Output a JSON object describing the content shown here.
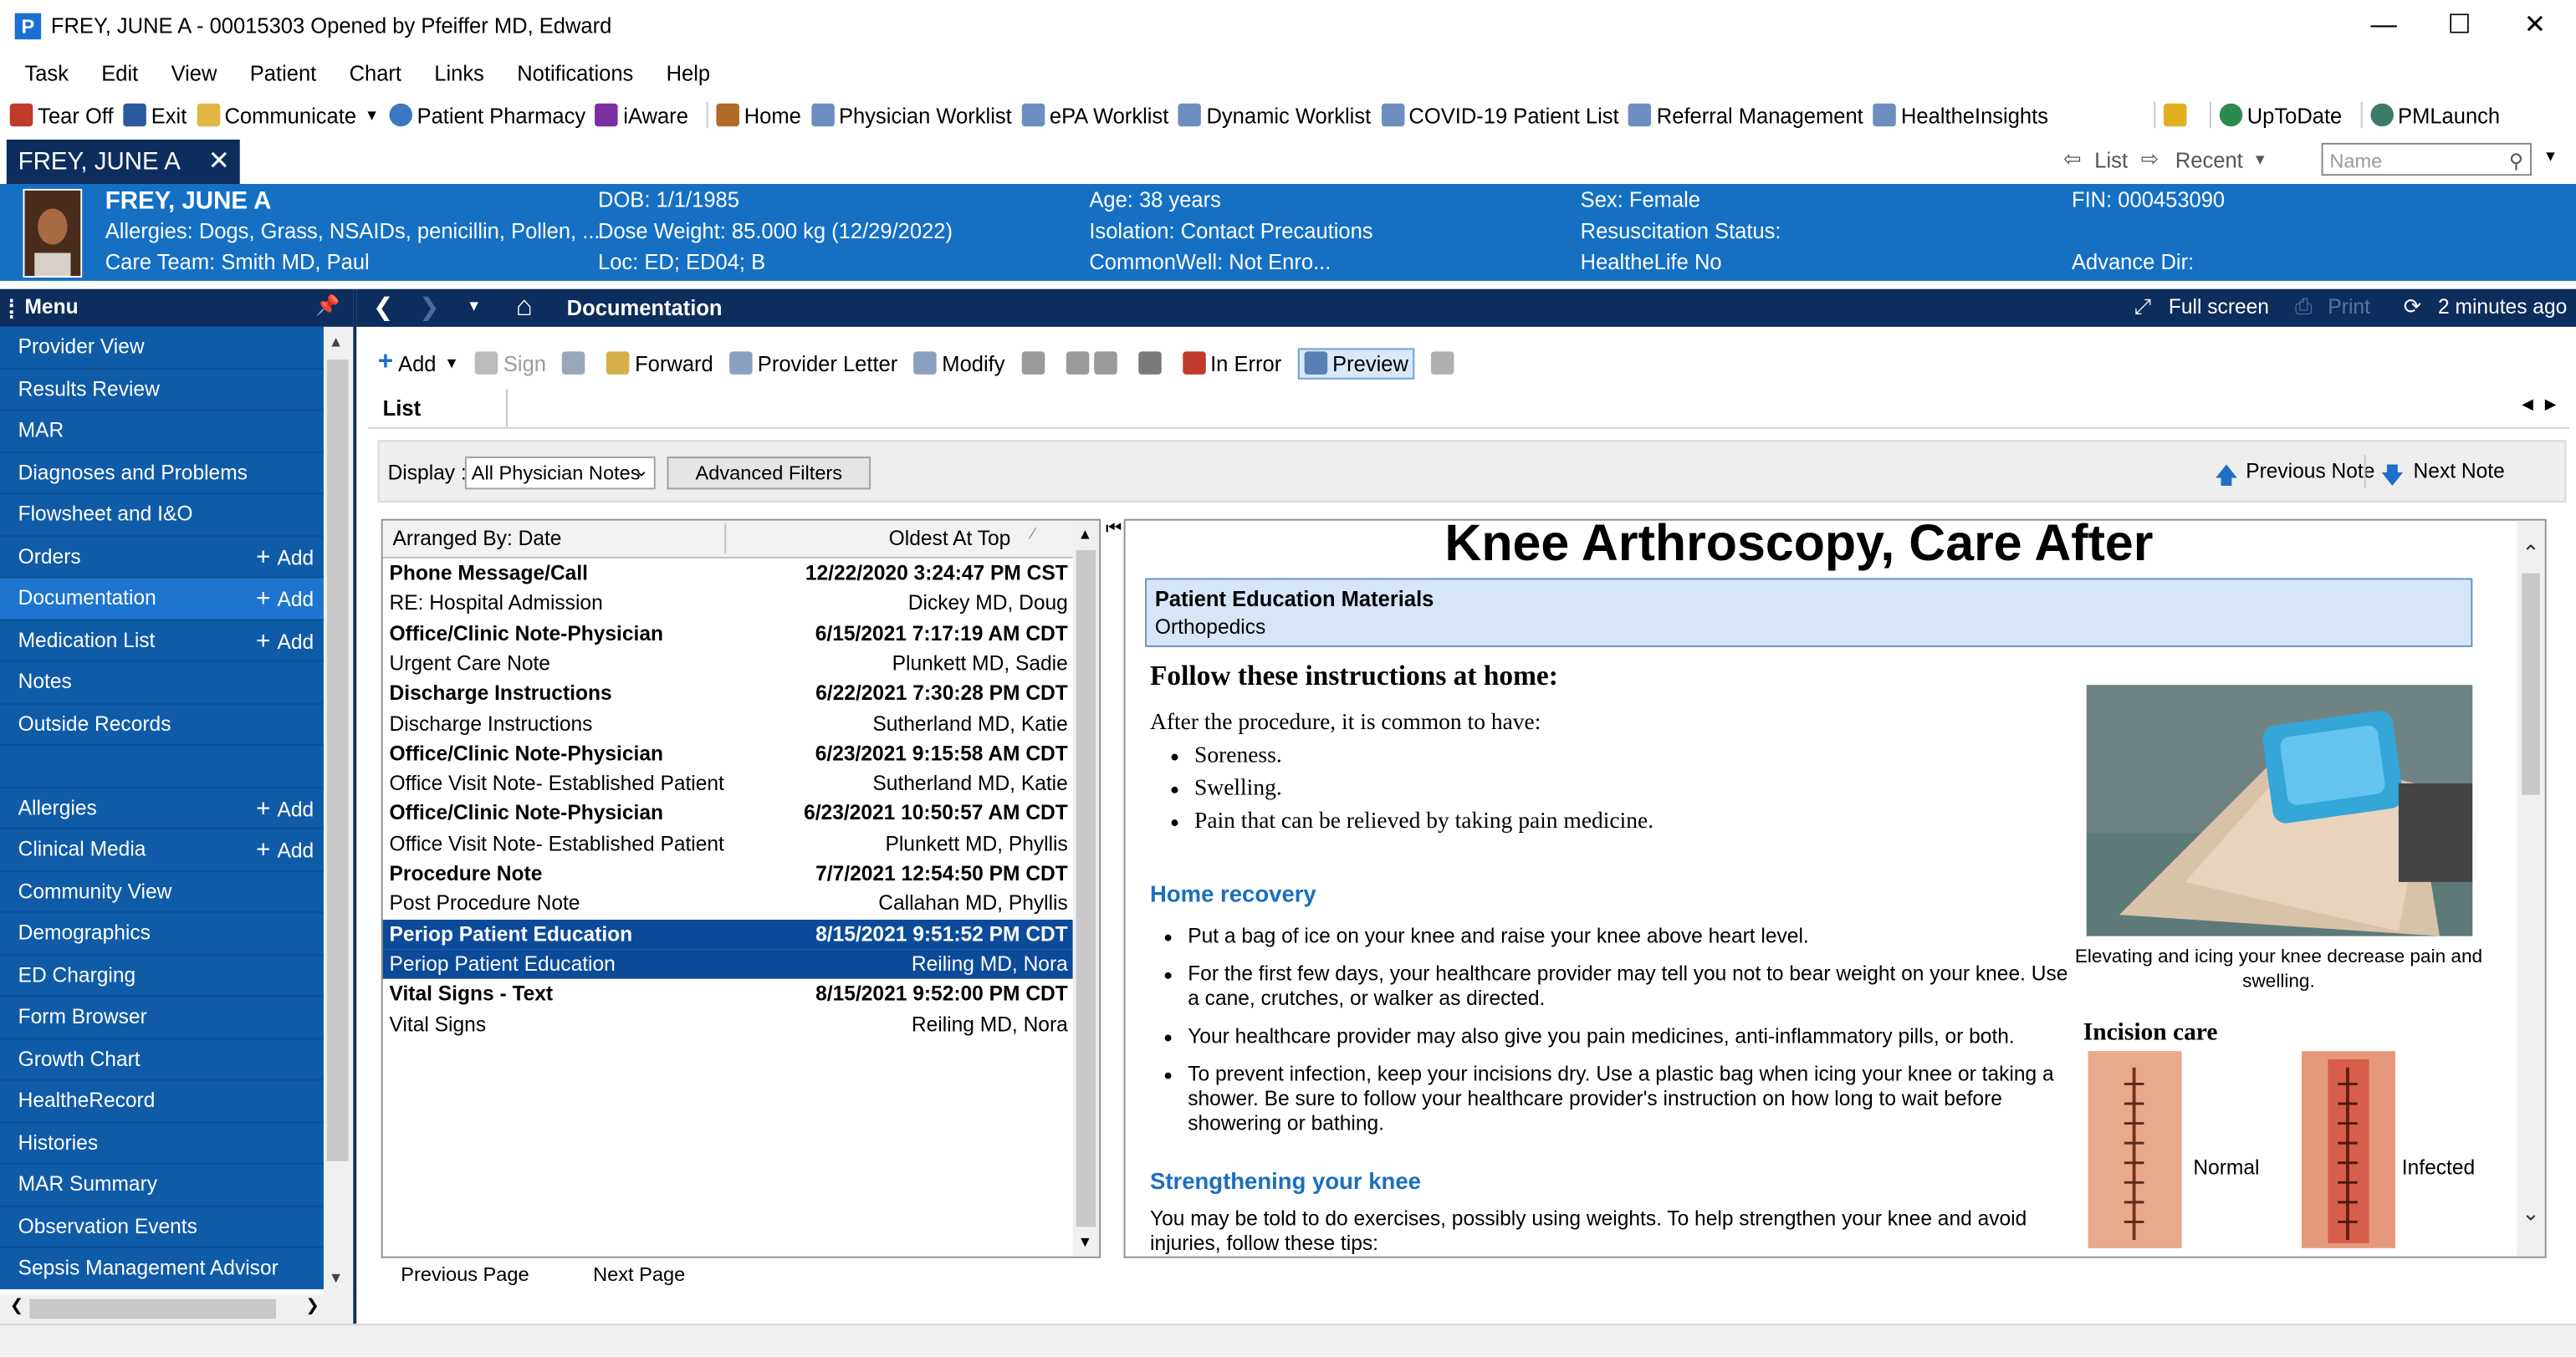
{
  "window": {
    "title": "FREY, JUNE A - 00015303 Opened by Pfeiffer MD, Edward",
    "app_icon_letter": "P"
  },
  "menubar": [
    "Task",
    "Edit",
    "View",
    "Patient",
    "Chart",
    "Links",
    "Notifications",
    "Help"
  ],
  "toolbar": {
    "tear_off": "Tear Off",
    "exit": "Exit",
    "communicate": "Communicate",
    "patient_pharmacy": "Patient Pharmacy",
    "iaware": "iAware",
    "home": "Home",
    "physician_worklist": "Physician Worklist",
    "epa_worklist": "ePA Worklist",
    "dynamic_worklist": "Dynamic Worklist",
    "covid_list": "COVID-19 Patient List",
    "referral": "Referral Management",
    "healtheinsights": "HealtheInsights",
    "uptodate": "UpToDate",
    "pmlaunch": "PMLaunch"
  },
  "tabs": {
    "patient_tab": "FREY, JUNE A",
    "list_btn": "List",
    "recent_btn": "Recent",
    "name_placeholder": "Name"
  },
  "banner": {
    "name": "FREY, JUNE A",
    "allergies": "Allergies: Dogs, Grass, NSAIDs, penicillin, Pollen, ...",
    "care_team": "Care Team: Smith MD, Paul",
    "dob": "DOB: 1/1/1985",
    "dose_weight": "Dose Weight: 85.000 kg (12/29/2022)",
    "loc": "Loc: ED; ED04; B",
    "age": "Age: 38 years",
    "isolation": "Isolation: Contact Precautions",
    "commonwell": "CommonWell: Not Enro...",
    "sex": "Sex: Female",
    "resus": "Resuscitation Status:",
    "healthelife": "HealtheLife No",
    "fin": "FIN: 000453090",
    "advance_dir": "Advance Dir:"
  },
  "sidebar": {
    "header": "Menu",
    "add_label": "Add",
    "items": [
      {
        "label": "Provider View",
        "add": false
      },
      {
        "label": "Results Review",
        "add": false
      },
      {
        "label": "MAR",
        "add": false
      },
      {
        "label": "Diagnoses and Problems",
        "add": false
      },
      {
        "label": "Flowsheet and I&O",
        "add": false
      },
      {
        "label": "Orders",
        "add": true
      },
      {
        "label": "Documentation",
        "add": true
      },
      {
        "label": "Medication List",
        "add": true
      },
      {
        "label": "Notes",
        "add": false
      },
      {
        "label": "Outside Records",
        "add": false
      },
      {
        "label": "",
        "add": false
      },
      {
        "label": "Allergies",
        "add": true
      },
      {
        "label": "Clinical Media",
        "add": true
      },
      {
        "label": "Community View",
        "add": false
      },
      {
        "label": "Demographics",
        "add": false
      },
      {
        "label": "ED Charging",
        "add": false
      },
      {
        "label": "Form Browser",
        "add": false
      },
      {
        "label": "Growth Chart",
        "add": false
      },
      {
        "label": "HealtheRecord",
        "add": false
      },
      {
        "label": "Histories",
        "add": false
      },
      {
        "label": "MAR Summary",
        "add": false
      },
      {
        "label": "Observation Events",
        "add": false
      },
      {
        "label": "Sepsis Management Advisor",
        "add": false
      }
    ]
  },
  "doc_header": {
    "title": "Documentation",
    "full_screen": "Full screen",
    "print": "Print",
    "refresh_time": "2 minutes ago"
  },
  "doc_toolbar": {
    "add": "Add",
    "sign": "Sign",
    "forward": "Forward",
    "provider_letter": "Provider Letter",
    "modify": "Modify",
    "in_error": "In Error",
    "preview": "Preview"
  },
  "list_tab": "List",
  "filter": {
    "display_label": "Display :",
    "display_value": "All Physician Notes",
    "advanced_filters": "Advanced Filters",
    "previous_note": "Previous Note",
    "next_note": "Next Note"
  },
  "note_list": {
    "arranged_by": "Arranged By: Date",
    "sort": "Oldest At Top",
    "rows": [
      {
        "l": "Phone Message/Call",
        "r": "12/22/2020 3:24:47 PM CST",
        "bold": true,
        "sel": false
      },
      {
        "l": "RE: Hospital Admission",
        "r": "Dickey MD, Doug",
        "bold": false,
        "sel": false
      },
      {
        "l": "Office/Clinic Note-Physician",
        "r": "6/15/2021 7:17:19 AM CDT",
        "bold": true,
        "sel": false
      },
      {
        "l": "Urgent Care Note",
        "r": "Plunkett MD, Sadie",
        "bold": false,
        "sel": false
      },
      {
        "l": "Discharge Instructions",
        "r": "6/22/2021 7:30:28 PM CDT",
        "bold": true,
        "sel": false
      },
      {
        "l": "Discharge Instructions",
        "r": "Sutherland MD, Katie",
        "bold": false,
        "sel": false
      },
      {
        "l": "Office/Clinic Note-Physician",
        "r": "6/23/2021 9:15:58 AM CDT",
        "bold": true,
        "sel": false
      },
      {
        "l": "Office Visit Note- Established Patient",
        "r": "Sutherland MD, Katie",
        "bold": false,
        "sel": false
      },
      {
        "l": "Office/Clinic Note-Physician",
        "r": "6/23/2021 10:50:57 AM CDT",
        "bold": true,
        "sel": false
      },
      {
        "l": "Office Visit Note- Established Patient",
        "r": "Plunkett MD, Phyllis",
        "bold": false,
        "sel": false
      },
      {
        "l": "Procedure Note",
        "r": "7/7/2021 12:54:50 PM CDT",
        "bold": true,
        "sel": false
      },
      {
        "l": "Post Procedure Note",
        "r": "Callahan MD, Phyllis",
        "bold": false,
        "sel": false
      },
      {
        "l": "Periop Patient Education",
        "r": "8/15/2021 9:51:52 PM CDT",
        "bold": true,
        "sel": true
      },
      {
        "l": "Periop Patient Education",
        "r": "Reiling MD, Nora",
        "bold": false,
        "sel": true
      },
      {
        "l": "Vital Signs - Text",
        "r": "8/15/2021 9:52:00 PM CDT",
        "bold": true,
        "sel": false
      },
      {
        "l": "Vital Signs",
        "r": "Reiling MD, Nora",
        "bold": false,
        "sel": false
      }
    ],
    "previous_page": "Previous Page",
    "next_page": "Next Page"
  },
  "preview": {
    "title": "Knee Arthroscopy, Care After",
    "box_title": "Patient Education Materials",
    "box_sub": "Orthopedics",
    "follow": "Follow these instructions at home:",
    "after": "After the procedure, it is common to have:",
    "common": [
      "Soreness.",
      "Swelling.",
      "Pain that can be relieved by taking pain medicine."
    ],
    "home_recovery": "Home recovery",
    "recovery_items": [
      "Put a bag of ice on your knee and raise your knee above heart level.",
      "For the first few days, your healthcare provider may tell you not to bear weight on your knee. Use a cane, crutches, or walker as directed.",
      "Your healthcare provider may also give you pain medicines, anti-inflammatory pills, or both.",
      "To prevent infection, keep your incisions dry. Use a plastic bag when icing your knee or taking a shower. Be sure to follow your healthcare provider's instruction on how long to wait before showering or bathing."
    ],
    "image_caption": "Elevating and icing your knee decrease pain and swelling.",
    "incision_care": "Incision care",
    "normal": "Normal",
    "infected": "Infected",
    "strengthening": "Strengthening your knee",
    "strength_text": "You may be told to do exercises, possibly using weights. To help strengthen your knee and avoid injuries, follow these tips:"
  }
}
